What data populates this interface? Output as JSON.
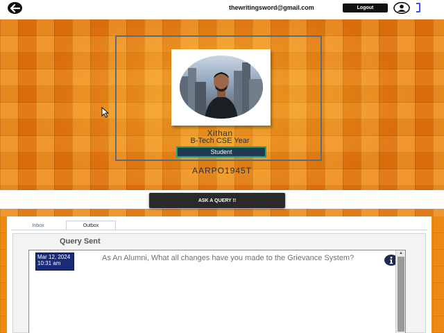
{
  "header": {
    "email": "thewritingsword@gmail.com",
    "logout_label": "Logout",
    "back_icon": "arrow-left-icon",
    "avatar_icon": "user-circle-icon"
  },
  "profile": {
    "name": "Xithan",
    "course": "B-Tech CSE  Year",
    "role": "Student",
    "user_id": "AARPO1945T"
  },
  "actions": {
    "ask_query_label": "ASK A QUERY !!"
  },
  "tabs": [
    {
      "label": "Inbox",
      "active": false
    },
    {
      "label": "Outbox",
      "active": true
    }
  ],
  "queries": {
    "title": "Query Sent",
    "items": [
      {
        "date": "Mar 12, 2024 10:31 am",
        "text": "As An Alumni, What all changes have you made to the Grievance System?",
        "icon": "info-icon"
      }
    ]
  },
  "colors": {
    "accent_dark": "#111111",
    "role_badge_bg": "#203a4f",
    "role_badge_border": "#1ea17a",
    "date_chip_bg": "#1a2b7a",
    "hero_orange": "#e87a10"
  }
}
